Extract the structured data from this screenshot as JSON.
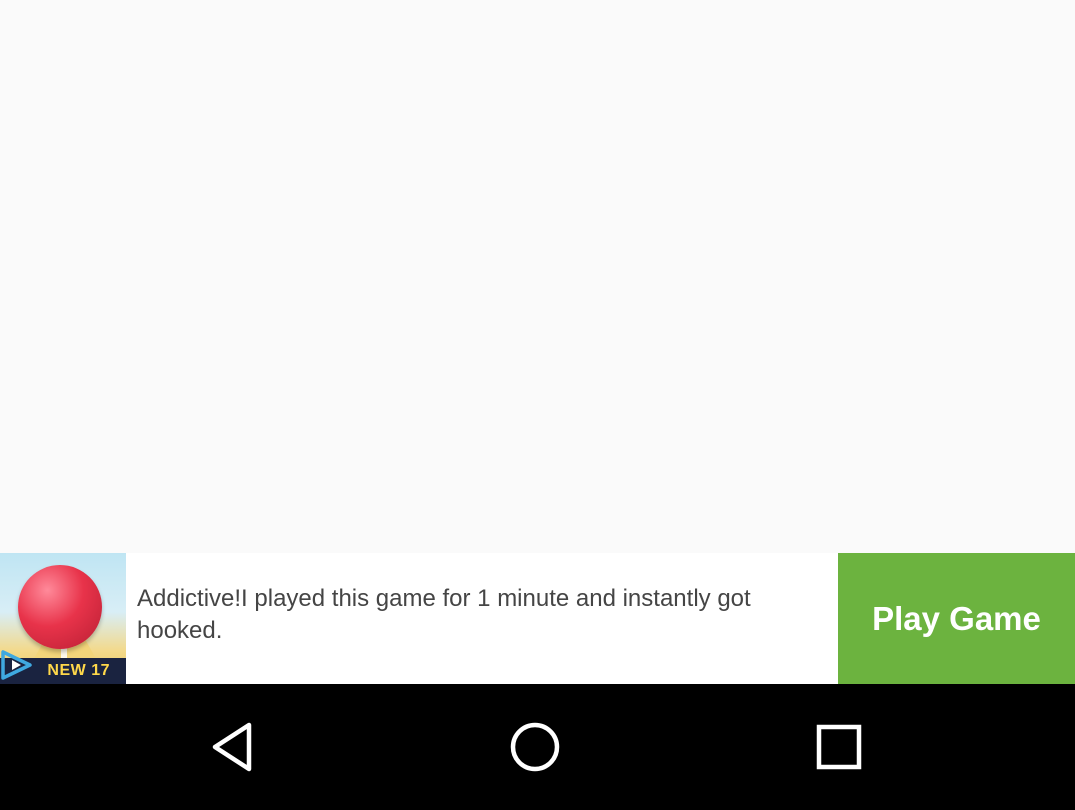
{
  "ad": {
    "thumbnail_label": "NEW 17",
    "text": "Addictive!I played this game for 1 minute and instantly got hooked.",
    "cta_label": "Play Game",
    "cta_color": "#6cb33f"
  },
  "nav": {
    "back_icon": "back-triangle",
    "home_icon": "home-circle",
    "recents_icon": "recents-square"
  }
}
